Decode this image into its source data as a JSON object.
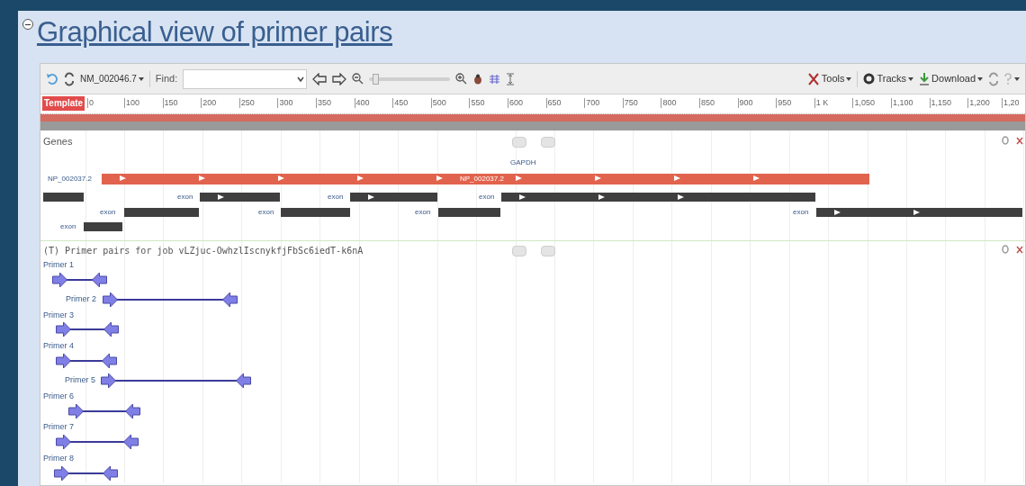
{
  "title": "Graphical view of primer pairs",
  "toolbar": {
    "sequence": "NM_002046.7",
    "find_label": "Find:",
    "slider": {
      "level": 0.04
    },
    "menus": [
      "Tools",
      "Tracks",
      "Download"
    ]
  },
  "ruler": {
    "label": "Template",
    "ticks": [
      "0",
      "100",
      "150",
      "200",
      "250",
      "300",
      "350",
      "400",
      "450",
      "500",
      "550",
      "600",
      "650",
      "700",
      "750",
      "800",
      "850",
      "900",
      "950",
      "1 K",
      "1,050",
      "1,100",
      "1,150",
      "1,200",
      "1,20"
    ]
  },
  "genes_track": {
    "title": "Genes",
    "gene": "GAPDH",
    "features": [
      {
        "kind": "mrna",
        "label": "NP_002037.2",
        "inner_label": "NP_002037.2"
      },
      {
        "kind": "exon"
      },
      {
        "kind": "exon",
        "label": "exon"
      },
      {
        "kind": "exon",
        "label": "exon"
      },
      {
        "kind": "exon",
        "label": "exon"
      },
      {
        "kind": "exon",
        "label": "exon"
      },
      {
        "kind": "exon",
        "label": "exon"
      },
      {
        "kind": "exon",
        "label": "exon"
      },
      {
        "kind": "exon",
        "label": "exon"
      },
      {
        "kind": "exon",
        "label": "exon"
      }
    ]
  },
  "primer_track": {
    "title": "(T) Primer pairs for job vLZjuc-OwhzlIscnykfjFbSc6iedT-k6nA",
    "primers": [
      {
        "label": "Primer 1"
      },
      {
        "label": "Primer 2"
      },
      {
        "label": "Primer 3"
      },
      {
        "label": "Primer 4"
      },
      {
        "label": "Primer 5"
      },
      {
        "label": "Primer 6"
      },
      {
        "label": "Primer 7"
      },
      {
        "label": "Primer 8"
      }
    ]
  }
}
